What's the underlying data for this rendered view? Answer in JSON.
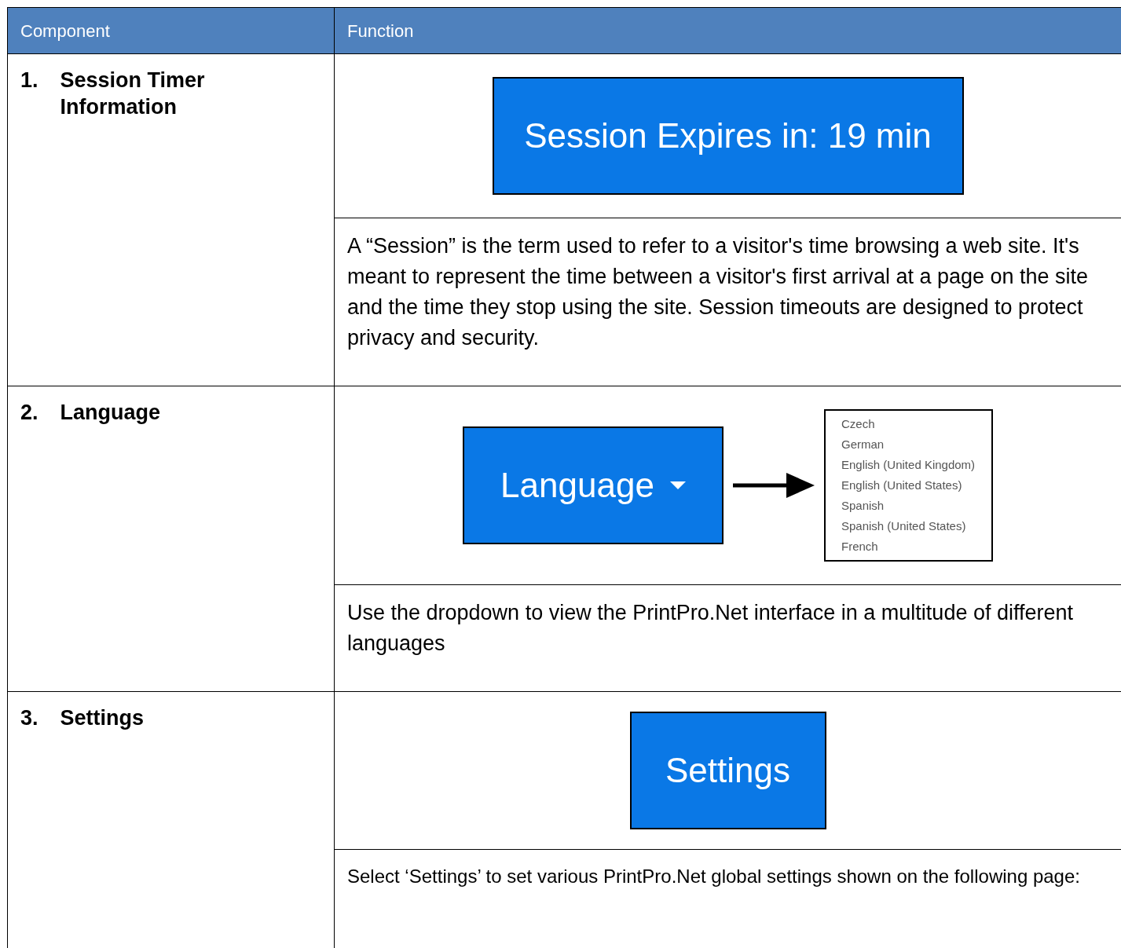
{
  "table": {
    "columns": [
      "Component",
      "Function"
    ],
    "rows": [
      {
        "number": "1.",
        "component": "Session Timer Information",
        "function": [
          {
            "kind": "button",
            "label": "Session Expires in: 19 min"
          },
          {
            "kind": "text",
            "text": "A “Session” is the term used to refer to a visitor's time browsing a web site. It's meant to represent the time between a visitor's first arrival at a page on the site and the time they stop using the site. Session timeouts are designed to protect privacy and security."
          }
        ]
      },
      {
        "number": "2.",
        "component": "Language",
        "function": [
          {
            "kind": "dropdown",
            "label": "Language",
            "options": [
              "Czech",
              "German",
              "English (United Kingdom)",
              "English (United States)",
              "Spanish",
              "Spanish (United States)",
              "French"
            ]
          },
          {
            "kind": "text",
            "text": "Use the dropdown to view the PrintPro.Net interface in a multitude of different languages"
          }
        ]
      },
      {
        "number": "3.",
        "component": "Settings",
        "function": [
          {
            "kind": "button",
            "label": "Settings"
          },
          {
            "kind": "text",
            "text": "Select ‘Settings’ to set various PrintPro.Net global settings shown on the following page:"
          }
        ]
      }
    ]
  }
}
